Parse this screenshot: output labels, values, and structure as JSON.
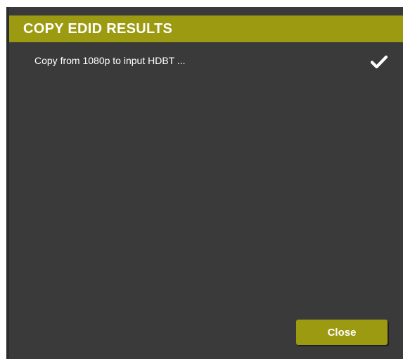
{
  "dialog": {
    "title": "COPY EDID RESULTS",
    "results": [
      {
        "text": "Copy from 1080p to input HDBT ...",
        "status_icon": "check-icon"
      }
    ],
    "close_label": "Close"
  },
  "colors": {
    "accent": "#9c9a10",
    "background": "#3a3a3a",
    "text": "#ffffff"
  }
}
